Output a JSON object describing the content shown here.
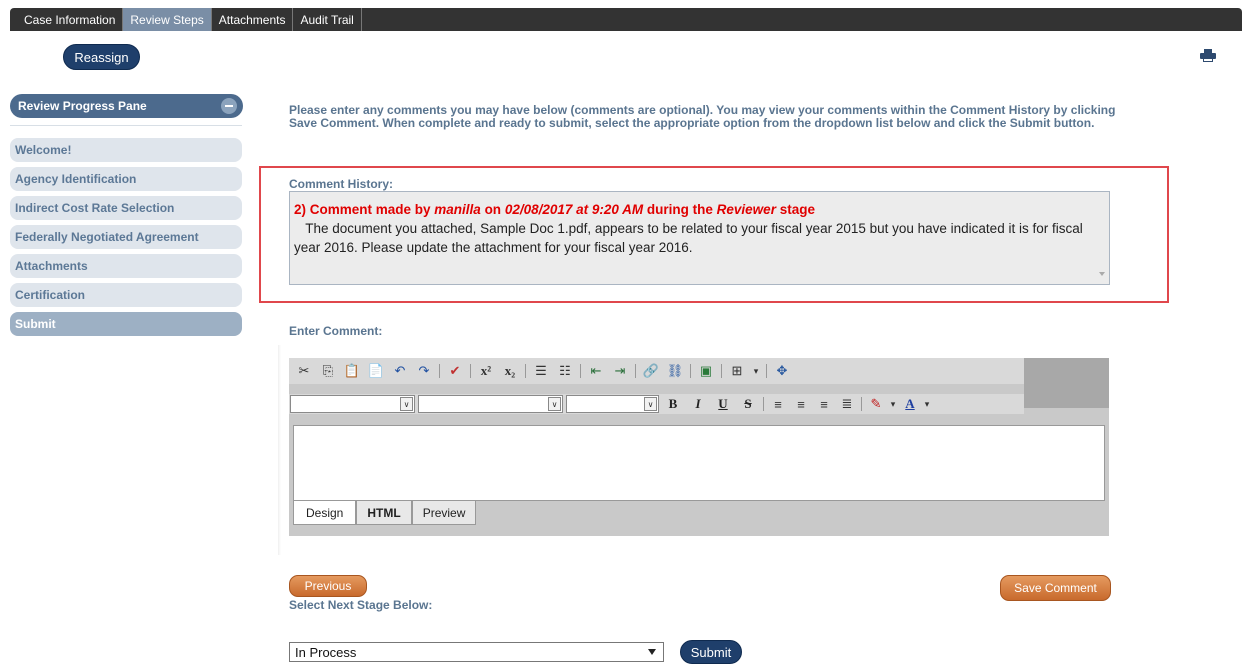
{
  "tabs": [
    {
      "label": "Case Information",
      "active": false
    },
    {
      "label": "Review Steps",
      "active": true
    },
    {
      "label": "Attachments",
      "active": false
    },
    {
      "label": "Audit Trail",
      "active": false
    }
  ],
  "reassign_label": "Reassign",
  "print_icon": "printer-icon",
  "pane": {
    "title": "Review Progress Pane",
    "collapse_icon": "minus-icon",
    "steps": [
      {
        "label": "Welcome!"
      },
      {
        "label": "Agency Identification"
      },
      {
        "label": "Indirect Cost Rate Selection"
      },
      {
        "label": "Federally Negotiated Agreement"
      },
      {
        "label": "Attachments"
      },
      {
        "label": "Certification"
      },
      {
        "label": "Submit"
      }
    ],
    "current_step": "Submit"
  },
  "instructions": "Please enter any comments you may have below (comments are optional). You may view your comments within the Comment History by clicking Save Comment. When complete and ready to submit, select the appropriate option from the dropdown list below and click the Submit button.",
  "comment_history": {
    "label": "Comment History:",
    "entry": {
      "prefix": "2) Comment made by ",
      "user": "manilla",
      "on": " on ",
      "datetime": "02/08/2017 at 9:20 AM",
      "during": " during the ",
      "stage": "Reviewer",
      "suffix": " stage",
      "text": "The document you attached, Sample Doc 1.pdf, appears to be related to your fiscal year 2015 but you have indicated it is for fiscal year 2016.  Please update the attachment for your fiscal year 2016."
    }
  },
  "editor": {
    "label": "Enter Comment:",
    "toolbar_icons": [
      "cut-icon",
      "copy-icon",
      "paste-icon",
      "paste-text-icon",
      "undo-icon",
      "redo-icon",
      "spellcheck-icon",
      "superscript-icon",
      "subscript-icon",
      "ordered-list-icon",
      "unordered-list-icon",
      "outdent-icon",
      "indent-icon",
      "link-icon",
      "unlink-icon",
      "image-icon",
      "table-icon",
      "fullscreen-icon"
    ],
    "format_buttons": [
      "B",
      "I",
      "U",
      "S"
    ],
    "modes": [
      "Design",
      "HTML",
      "Preview"
    ],
    "active_mode": "Design",
    "value": ""
  },
  "buttons": {
    "previous": "Previous",
    "save_comment": "Save Comment",
    "submit": "Submit"
  },
  "next_stage": {
    "label": "Select Next Stage Below:",
    "selected": "In Process"
  }
}
